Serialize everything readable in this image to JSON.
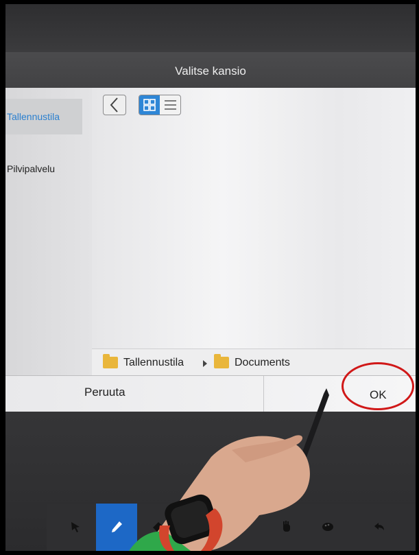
{
  "dialog": {
    "title": "Valitse kansio",
    "sidebar": {
      "items": [
        {
          "label": "Tallennustila",
          "active": true
        },
        {
          "label": "Pilvipalvelu",
          "active": false
        }
      ]
    },
    "view_mode": "grid",
    "path": {
      "crumbs": [
        "Tallennustila",
        "Documents"
      ]
    },
    "buttons": {
      "cancel": "Peruuta",
      "ok": "OK"
    }
  },
  "colors": {
    "accent": "#2e86d6",
    "highlight_ring": "#d01818",
    "folder": "#e9b63b"
  },
  "toolbar": {
    "icons": [
      "select-arrow-icon",
      "pen-icon",
      "eraser-icon",
      "hand-icon",
      "palette-icon",
      "undo-icon"
    ],
    "active": "pen-icon"
  }
}
